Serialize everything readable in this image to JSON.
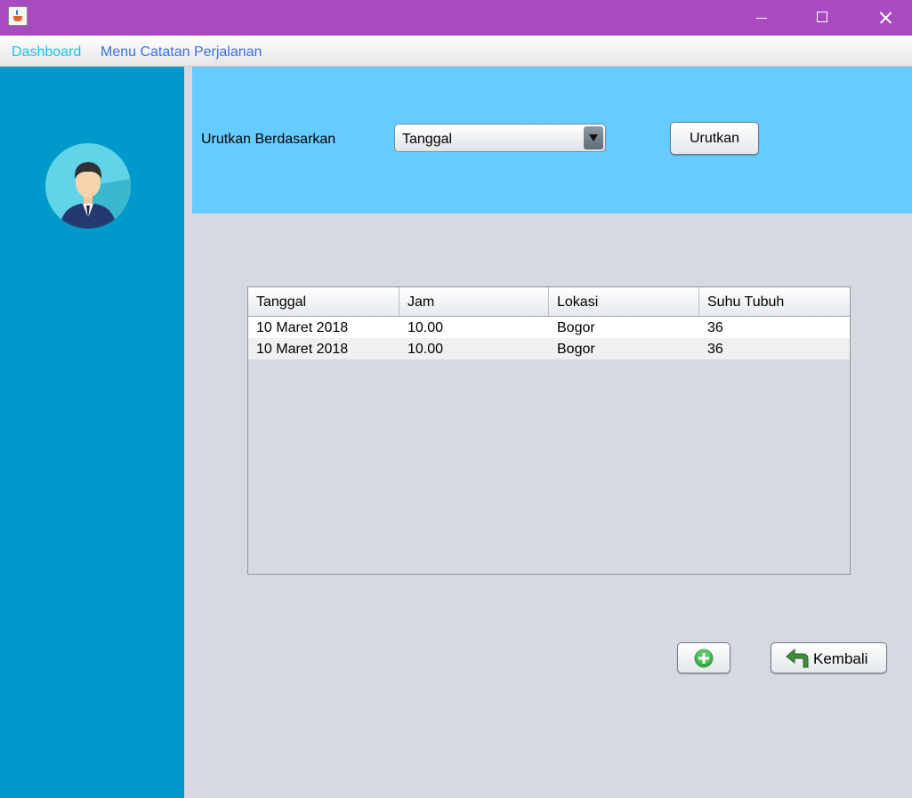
{
  "titlebar": {
    "app_icon": "java-cup-icon"
  },
  "menu": {
    "dashboard": "Dashboard",
    "catatan": "Menu Catatan Perjalanan"
  },
  "sort": {
    "label": "Urutkan Berdasarkan",
    "selected": "Tanggal",
    "button": "Urutkan"
  },
  "table": {
    "headers": [
      "Tanggal",
      "Jam",
      "Lokasi",
      "Suhu Tubuh"
    ],
    "rows": [
      [
        "10 Maret 2018",
        "10.00",
        "Bogor",
        "36"
      ],
      [
        "10 Maret 2018",
        "10.00",
        "Bogor",
        "36"
      ]
    ]
  },
  "actions": {
    "add_icon": "plus-circle-icon",
    "back_label": "Kembali",
    "back_icon": "back-arrow-icon"
  },
  "colors": {
    "titlebar": "#a84bc1",
    "sidebar": "#0099cc",
    "top_panel": "#66ccff",
    "content": "#d6d9e0"
  }
}
